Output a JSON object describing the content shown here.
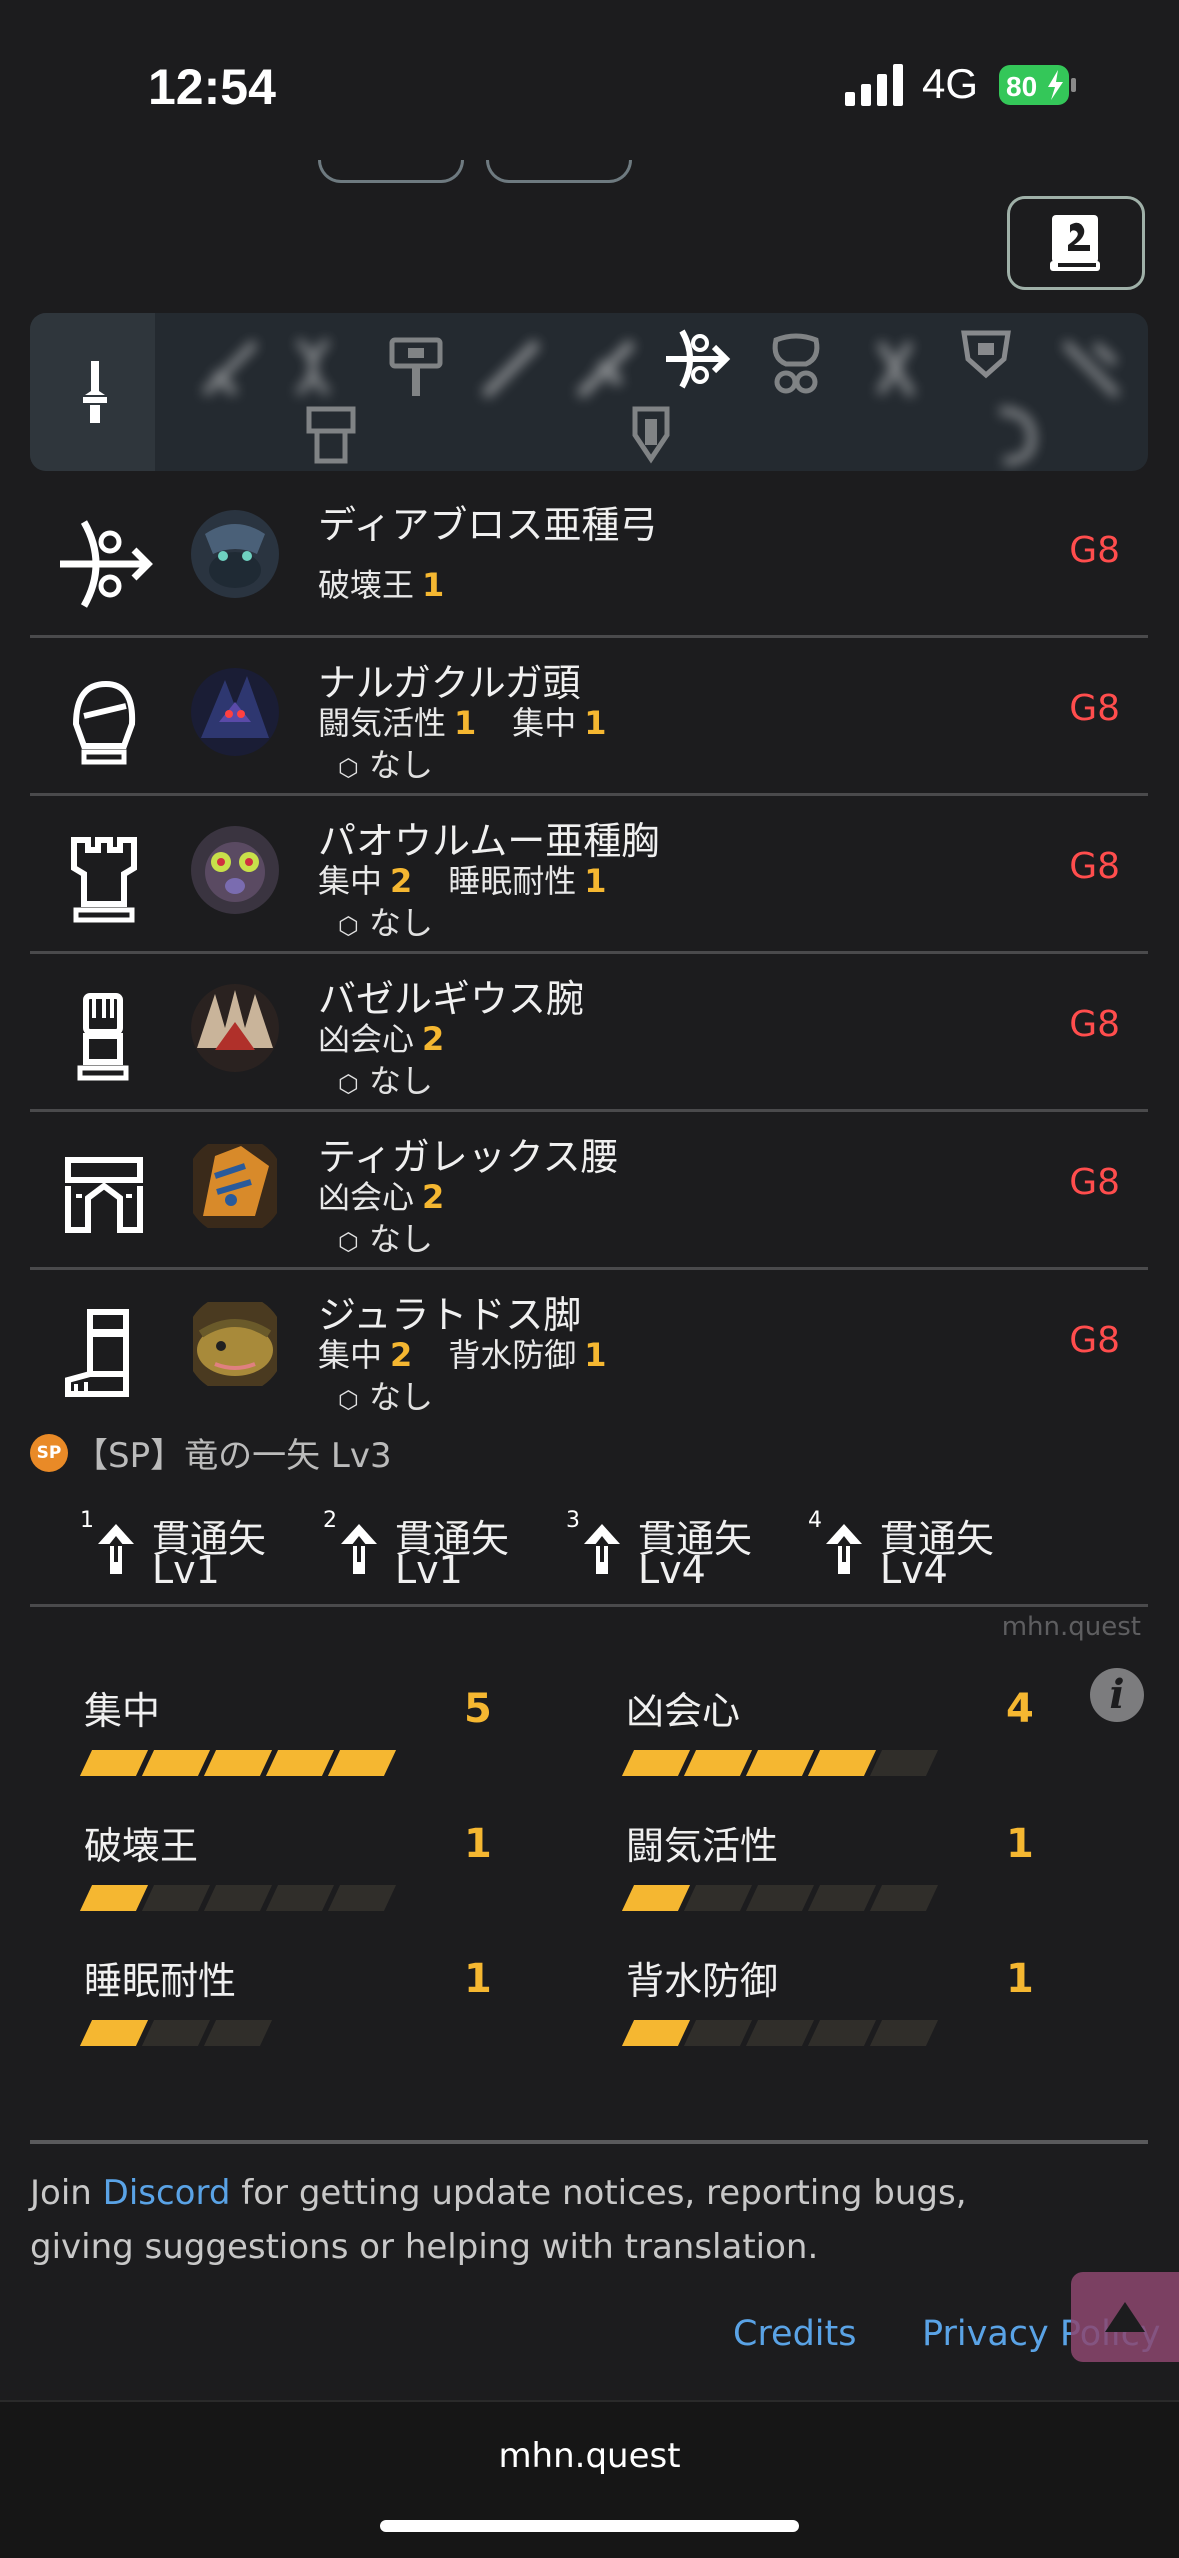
{
  "status_bar": {
    "time": "12:54",
    "network": "4G",
    "battery": "80"
  },
  "equipment": [
    {
      "name": "ディアブロス亜種弓",
      "skills": [
        {
          "name": "破壊王",
          "level": "1"
        }
      ],
      "slot": "",
      "grade": "G8"
    },
    {
      "name": "ナルガクルガ頭",
      "skills": [
        {
          "name": "闘気活性",
          "level": "1"
        },
        {
          "name": "集中",
          "level": "1"
        }
      ],
      "slot": "なし",
      "grade": "G8"
    },
    {
      "name": "パオウルムー亜種胸",
      "skills": [
        {
          "name": "集中",
          "level": "2"
        },
        {
          "name": "睡眠耐性",
          "level": "1"
        }
      ],
      "slot": "なし",
      "grade": "G8"
    },
    {
      "name": "バゼルギウス腕",
      "skills": [
        {
          "name": "凶会心",
          "level": "2"
        }
      ],
      "slot": "なし",
      "grade": "G8"
    },
    {
      "name": "ティガレックス腰",
      "skills": [
        {
          "name": "凶会心",
          "level": "2"
        }
      ],
      "slot": "なし",
      "grade": "G8"
    },
    {
      "name": "ジュラトドス脚",
      "skills": [
        {
          "name": "集中",
          "level": "2"
        },
        {
          "name": "背水防御",
          "level": "1"
        }
      ],
      "slot": "なし",
      "grade": "G8"
    }
  ],
  "sp": {
    "badge": "SP",
    "label": "【SP】竜の一矢 Lv3"
  },
  "arrows": [
    {
      "num": "1",
      "type": "貫通矢",
      "level": "Lv1"
    },
    {
      "num": "2",
      "type": "貫通矢",
      "level": "Lv1"
    },
    {
      "num": "3",
      "type": "貫通矢",
      "level": "Lv4"
    },
    {
      "num": "4",
      "type": "貫通矢",
      "level": "Lv4"
    }
  ],
  "site_small": "mhn.quest",
  "info_icon": "i",
  "skill_summary": [
    {
      "name": "集中",
      "value": "5",
      "filled": 5,
      "max": 5
    },
    {
      "name": "凶会心",
      "value": "4",
      "filled": 4,
      "max": 5
    },
    {
      "name": "破壊王",
      "value": "1",
      "filled": 1,
      "max": 5
    },
    {
      "name": "闘気活性",
      "value": "1",
      "filled": 1,
      "max": 5
    },
    {
      "name": "睡眠耐性",
      "value": "1",
      "filled": 1,
      "max": 3
    },
    {
      "name": "背水防御",
      "value": "1",
      "filled": 1,
      "max": 5
    }
  ],
  "footer": {
    "join_prefix": "Join ",
    "discord": "Discord",
    "join_suffix": " for getting update notices, reporting bugs, giving suggestions or helping with translation.",
    "credits": "Credits",
    "privacy": "Privacy Policy"
  },
  "browser": {
    "url": "mhn.quest"
  },
  "colors": {
    "accent": "#f5b731",
    "grade": "#ff4d4d",
    "link": "#5aa3e6"
  }
}
